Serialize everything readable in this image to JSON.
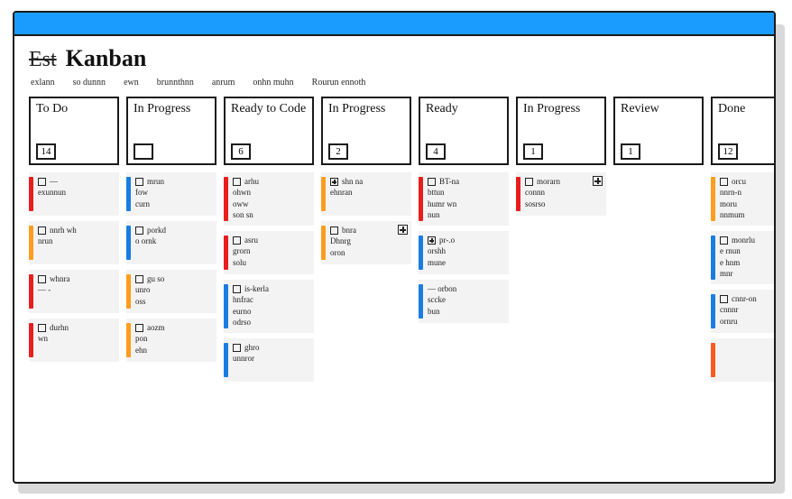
{
  "header": {
    "crumb_strike": "Est",
    "title": "Kanban"
  },
  "tabs": [
    "exlann",
    "so dunnn",
    "ewn",
    "brunnthnn",
    "anrum",
    "onhn muhn",
    "Rourun ennoth"
  ],
  "columns": [
    {
      "title": "To Do",
      "count": "14",
      "cards": [
        {
          "stripe": "s-red",
          "lines": [
            "—",
            "exunnun"
          ],
          "box": true
        },
        {
          "stripe": "s-orange",
          "lines": [
            "nnrh wh",
            "nrun"
          ],
          "box": true
        },
        {
          "stripe": "s-red",
          "lines": [
            "whnra",
            "— -"
          ],
          "box": true
        },
        {
          "stripe": "s-red",
          "lines": [
            "durhn",
            "wn"
          ],
          "box": true
        }
      ]
    },
    {
      "title": "In Progress",
      "count": "",
      "cards": [
        {
          "stripe": "s-blue",
          "lines": [
            "mrun",
            "fow",
            "curn"
          ],
          "box": true
        },
        {
          "stripe": "s-blue",
          "lines": [
            "porkd",
            "o ornk"
          ],
          "box": true
        },
        {
          "stripe": "s-orange",
          "lines": [
            "gu so",
            "unro",
            "oss"
          ],
          "box": true
        },
        {
          "stripe": "s-orange",
          "lines": [
            "aozm",
            "pon",
            "ehn"
          ],
          "box": true
        }
      ]
    },
    {
      "title": "Ready to Code",
      "count": "6",
      "cards": [
        {
          "stripe": "s-red",
          "lines": [
            "arhu",
            "ohwn",
            "oww",
            "son sn"
          ],
          "box": true
        },
        {
          "stripe": "s-red",
          "lines": [
            "asru",
            "grorn",
            "solu"
          ],
          "box": true
        },
        {
          "stripe": "s-blue",
          "lines": [
            "is-kerla",
            "hnfrac",
            "eurno",
            "odrso"
          ],
          "box": true
        },
        {
          "stripe": "s-blue",
          "lines": [
            "ghro",
            "unnror"
          ],
          "box": true
        }
      ]
    },
    {
      "title": "In Progress",
      "count": "2",
      "cards": [
        {
          "stripe": "s-orange",
          "lines": [
            "shn na",
            "ehnran"
          ],
          "box": "plus"
        },
        {
          "stripe": "s-orange",
          "lines": [
            "bnra",
            "Dhnrg",
            "oron"
          ],
          "box": true,
          "corner": true
        }
      ]
    },
    {
      "title": "Ready",
      "count": "4",
      "cards": [
        {
          "stripe": "s-red",
          "lines": [
            "BT-na",
            "bttun",
            "humr wn",
            "nun"
          ],
          "box": true
        },
        {
          "stripe": "s-blue",
          "lines": [
            "pr-.o",
            "orshh",
            "mune"
          ],
          "box": "plus"
        },
        {
          "stripe": "s-blue",
          "lines": [
            "— orbon",
            "sccke",
            "bun"
          ],
          "box": false
        }
      ]
    },
    {
      "title": "In Progress",
      "count": "1",
      "cards": [
        {
          "stripe": "s-red",
          "lines": [
            "morarn",
            "connn",
            "sosrso"
          ],
          "box": true,
          "corner": true
        }
      ]
    },
    {
      "title": "Review",
      "count": "1",
      "cards": []
    },
    {
      "title": "Done",
      "count": "12",
      "cards": [
        {
          "stripe": "s-orange",
          "lines": [
            "orcu",
            "nnrn-n",
            "moru",
            "nnmum"
          ],
          "box": true
        },
        {
          "stripe": "s-blue",
          "lines": [
            "monrlu",
            "e rnun",
            "e hnm",
            "mnr"
          ],
          "box": true
        },
        {
          "stripe": "s-blue",
          "lines": [
            "cnnr-on",
            "cnnnr",
            "ornru"
          ],
          "box": true
        },
        {
          "stripe": "s-orangered",
          "lines": [
            ""
          ],
          "box": false
        }
      ]
    }
  ]
}
